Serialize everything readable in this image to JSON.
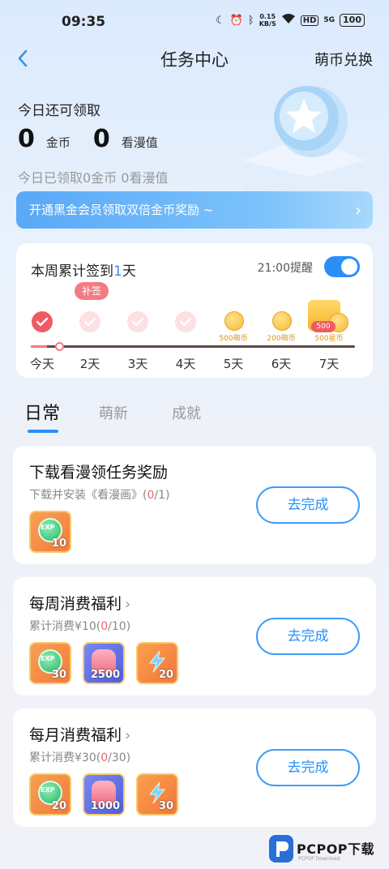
{
  "status_bar": {
    "time": "09:35",
    "net_speed_value": "0.15",
    "net_speed_unit": "KB/S",
    "hd_label": "HD",
    "signal_label": "5G",
    "battery": "100"
  },
  "header": {
    "title": "任务中心",
    "right_link": "萌币兑换"
  },
  "summary": {
    "claim_label": "今日还可领取",
    "coins_value": "0",
    "coins_unit": "金币",
    "watch_value": "0",
    "watch_unit": "看漫值",
    "claimed_line": "今日已领取0金币 0看漫值"
  },
  "vip_banner": {
    "text": "开通黑金会员领取双倍金币奖励 ~",
    "chevron": "›"
  },
  "signin": {
    "title_prefix": "本周累计签到",
    "count": "1",
    "title_suffix": "天",
    "reminder_label": "21:00提醒",
    "reminder_on": true,
    "makeup_label": "补签",
    "progress_fraction": 0.05,
    "days": [
      {
        "label": "今天",
        "state": "done",
        "reward": ""
      },
      {
        "label": "2天",
        "state": "pending",
        "reward": ""
      },
      {
        "label": "3天",
        "state": "pending",
        "reward": ""
      },
      {
        "label": "4天",
        "state": "pending",
        "reward": ""
      },
      {
        "label": "5天",
        "state": "coin",
        "reward": "500萌币"
      },
      {
        "label": "6天",
        "state": "coin",
        "reward": "200萌币"
      },
      {
        "label": "7天",
        "state": "star",
        "reward": "500星币",
        "badge": "500"
      }
    ]
  },
  "tabs": [
    {
      "label": "日常",
      "active": true
    },
    {
      "label": "萌新",
      "active": false
    },
    {
      "label": "成就",
      "active": false
    }
  ],
  "tasks": [
    {
      "title": "下载看漫领任务奖励",
      "has_chevron": false,
      "desc_prefix": "下载并安装《看漫画》(",
      "desc_done": "0",
      "desc_suffix": "/1)",
      "button": "去完成",
      "rewards": [
        {
          "type": "exp",
          "tag": "EXP",
          "qty": "10"
        }
      ]
    },
    {
      "title": "每周消费福利",
      "has_chevron": true,
      "desc_prefix": "累计消费¥10(",
      "desc_done": "0",
      "desc_suffix": "/10)",
      "button": "去完成",
      "rewards": [
        {
          "type": "exp",
          "tag": "EXP",
          "qty": "30"
        },
        {
          "type": "ticket",
          "tag": "",
          "qty": "2500"
        },
        {
          "type": "power",
          "tag": "",
          "qty": "20"
        }
      ]
    },
    {
      "title": "每月消费福利",
      "has_chevron": true,
      "desc_prefix": "累计消费¥30(",
      "desc_done": "0",
      "desc_suffix": "/30)",
      "button": "去完成",
      "rewards": [
        {
          "type": "exp",
          "tag": "EXP",
          "qty": "20"
        },
        {
          "type": "ticket",
          "tag": "",
          "qty": "1000"
        },
        {
          "type": "power",
          "tag": "",
          "qty": "30"
        }
      ]
    }
  ],
  "task_chevron": "›",
  "watermark": {
    "brand": "PCPOP下载",
    "sub": "PCPOP Download"
  },
  "colors": {
    "accent": "#2a8ff7",
    "done_red": "#ef5a63",
    "coin_gold": "#f6b93a"
  }
}
